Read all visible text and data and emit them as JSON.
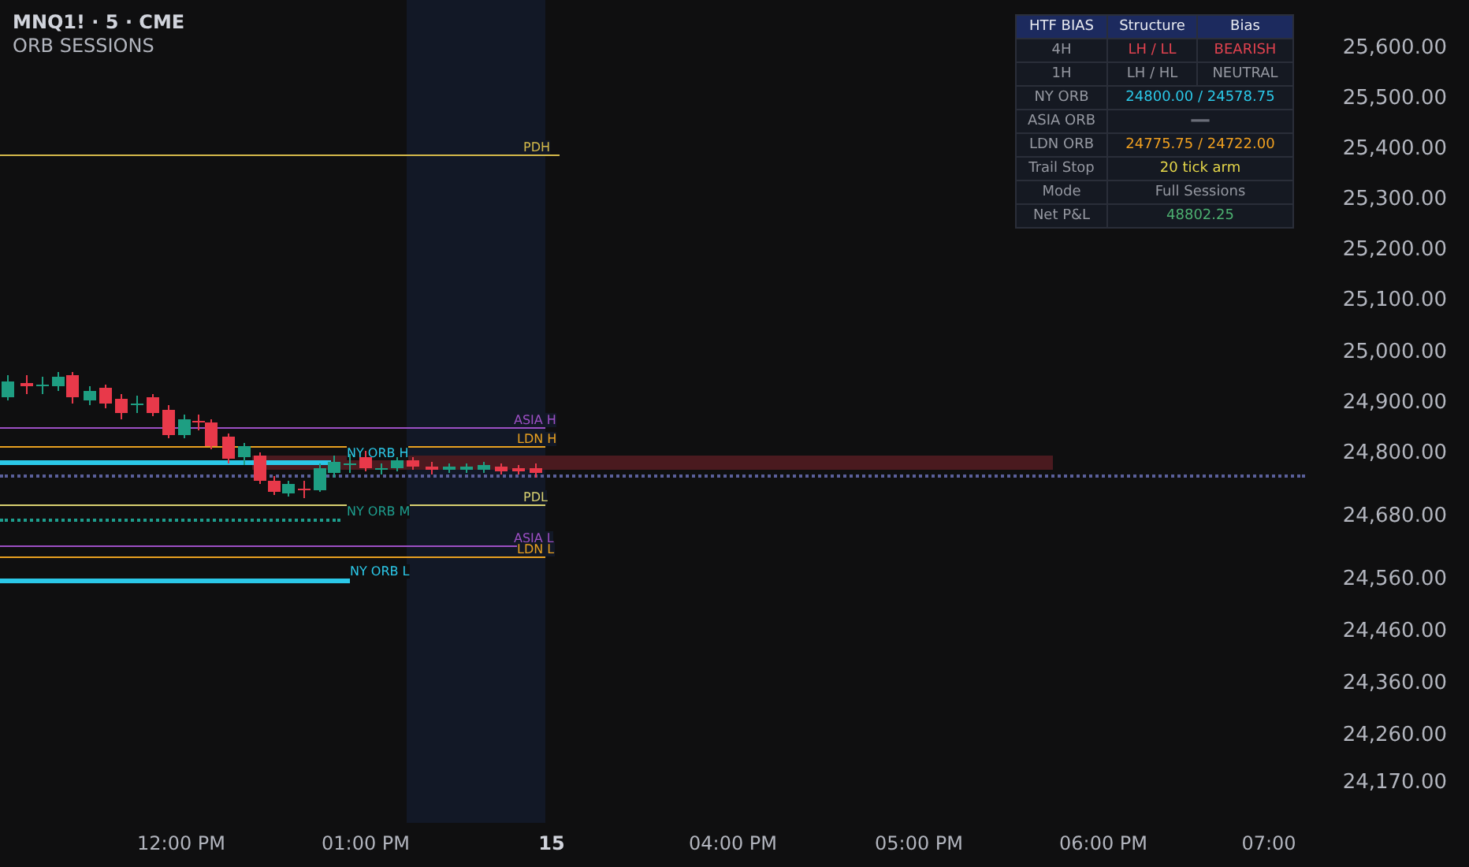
{
  "legend": {
    "symbol": "MNQ1! · 5 · CME",
    "indicator": "ORB SESSIONS"
  },
  "bias_table": {
    "header": [
      "HTF BIAS",
      "Structure",
      "Bias"
    ],
    "rows": [
      {
        "label": "4H",
        "cells": [
          {
            "text": "LH / LL",
            "color": "#e0424f"
          },
          {
            "text": "BEARISH",
            "color": "#e0424f"
          }
        ]
      },
      {
        "label": "1H",
        "cells": [
          {
            "text": "LH / HL",
            "color": "#9598a1"
          },
          {
            "text": "NEUTRAL",
            "color": "#9598a1"
          }
        ]
      },
      {
        "label": "NY ORB",
        "cells": [
          {
            "text": "24800.00 / 24578.75",
            "color": "#2bc8e8"
          }
        ]
      },
      {
        "label": "ASIA ORB",
        "cells": [
          {
            "text": "—",
            "color": "#6a6d78"
          }
        ]
      },
      {
        "label": "LDN ORB",
        "cells": [
          {
            "text": "24775.75 / 24722.00",
            "color": "#f0a020"
          }
        ]
      },
      {
        "label": "Trail Stop",
        "cells": [
          {
            "text": "20 tick arm",
            "color": "#e6d84a"
          }
        ]
      },
      {
        "label": "Mode",
        "cells": [
          {
            "text": "Full Sessions",
            "color": "#9598a1"
          }
        ]
      },
      {
        "label": "Net P&L",
        "cells": [
          {
            "text": "48802.25",
            "color": "#4caf70"
          }
        ]
      }
    ]
  },
  "levels": [
    {
      "label": "PDH",
      "color": "#d4b94a"
    },
    {
      "label": "ASIA H",
      "color": "#9c4fc4"
    },
    {
      "label": "LDN H",
      "color": "#e8a020"
    },
    {
      "label": "NY ORB H",
      "color": "#2bc8e8"
    },
    {
      "label": "PDL",
      "color": "#d8d070"
    },
    {
      "label": "NY ORB M",
      "color": "#1e9e8e"
    },
    {
      "label": "ASIA L",
      "color": "#9c4fc4"
    },
    {
      "label": "LDN L",
      "color": "#e8a020"
    },
    {
      "label": "NY ORB L",
      "color": "#2bc8e8"
    }
  ],
  "price_axis": [
    "25,600.00",
    "25,500.00",
    "25,400.00",
    "25,300.00",
    "25,200.00",
    "25,100.00",
    "25,000.00",
    "24,900.00",
    "24,800.00",
    "24,680.00",
    "24,560.00",
    "24,460.00",
    "24,360.00",
    "24,260.00",
    "24,170.00"
  ],
  "time_axis": [
    {
      "label": "12:00 PM",
      "kind": "time"
    },
    {
      "label": "01:00 PM",
      "kind": "time"
    },
    {
      "label": "15",
      "kind": "day"
    },
    {
      "label": "04:00 PM",
      "kind": "time"
    },
    {
      "label": "05:00 PM",
      "kind": "time"
    },
    {
      "label": "06:00 PM",
      "kind": "time"
    },
    {
      "label": "07:00",
      "kind": "time"
    }
  ]
}
